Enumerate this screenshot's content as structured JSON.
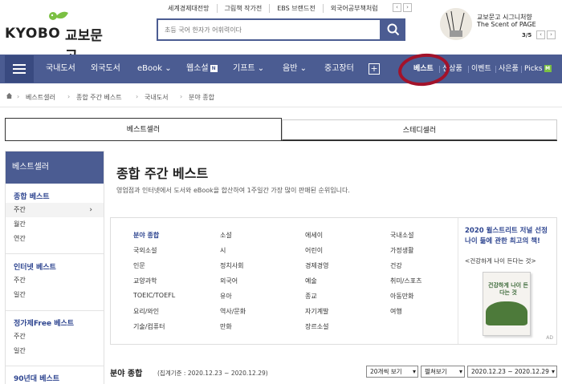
{
  "header": {
    "logo_en": "KYOBO",
    "logo_kr": "교보문고",
    "top_links": [
      "세계경제대전망",
      "그림책 작가전",
      "EBS 브랜드전",
      "외국어공부책처럼"
    ],
    "search_placeholder": "초등 국어 한자가 어휘력이다",
    "promo": {
      "line1": "교보문고 시그니처향",
      "line2": "The Scent of PAGE",
      "page": "3/5"
    }
  },
  "nav": {
    "items": [
      "국내도서",
      "외국도서",
      "eBook",
      "웹소설",
      "기프트",
      "음반",
      "중고장터"
    ],
    "sub_items": [
      "베스트",
      "신상품",
      "이벤트",
      "사은품",
      "Picks"
    ]
  },
  "breadcrumb": [
    "베스트셀러",
    "종합 주간 베스트",
    "국내도서",
    "분야 종합"
  ],
  "tabs": [
    "베스트셀러",
    "스테디셀러"
  ],
  "sidebar": {
    "header": "베스트셀러",
    "groups": [
      {
        "title": "종합 베스트",
        "items": [
          "주간",
          "월간",
          "연간"
        ]
      },
      {
        "title": "인터넷 베스트",
        "items": [
          "주간",
          "일간"
        ]
      },
      {
        "title": "정가제Free 베스트",
        "items": [
          "주간",
          "일간"
        ]
      },
      {
        "title": "90년대 베스트",
        "items": []
      }
    ]
  },
  "main": {
    "title": "종합 주간 베스트",
    "description": "영업점과 인터넷에서 도서와 eBook을 합산하여 1주일간 가장 많이 판매된 순위입니다.",
    "categories": [
      [
        "분야 종합",
        "소설",
        "에세이",
        "국내소설"
      ],
      [
        "국외소설",
        "시",
        "어린이",
        "가정생활"
      ],
      [
        "인문",
        "정치사회",
        "경제경영",
        "건강"
      ],
      [
        "교양과학",
        "외국어",
        "예술",
        "취미/스포츠"
      ],
      [
        "TOEIC/TOEFL",
        "유아",
        "종교",
        "아동만화"
      ],
      [
        "요리/와인",
        "역사/문화",
        "자기계발",
        "여행"
      ],
      [
        "기술/컴퓨터",
        "만화",
        "장르소설",
        ""
      ]
    ],
    "ad": {
      "line1": "2020 윌스트리트 저널 선정",
      "line2": "나이 듦에 관한 최고의 책!",
      "line3": "<건강하게 나이 든다는 것>",
      "book_title": "건강하게 나이 든다는 것",
      "ad_label": "AD"
    }
  },
  "bottom": {
    "title": "분야 종합",
    "period": "(집계기준 : 2020.12.23 ~ 2020.12.29)",
    "select1": "20개씩 보기",
    "select2": "펼쳐보기",
    "select3": "2020.12.23 ~ 2020.12.29"
  }
}
